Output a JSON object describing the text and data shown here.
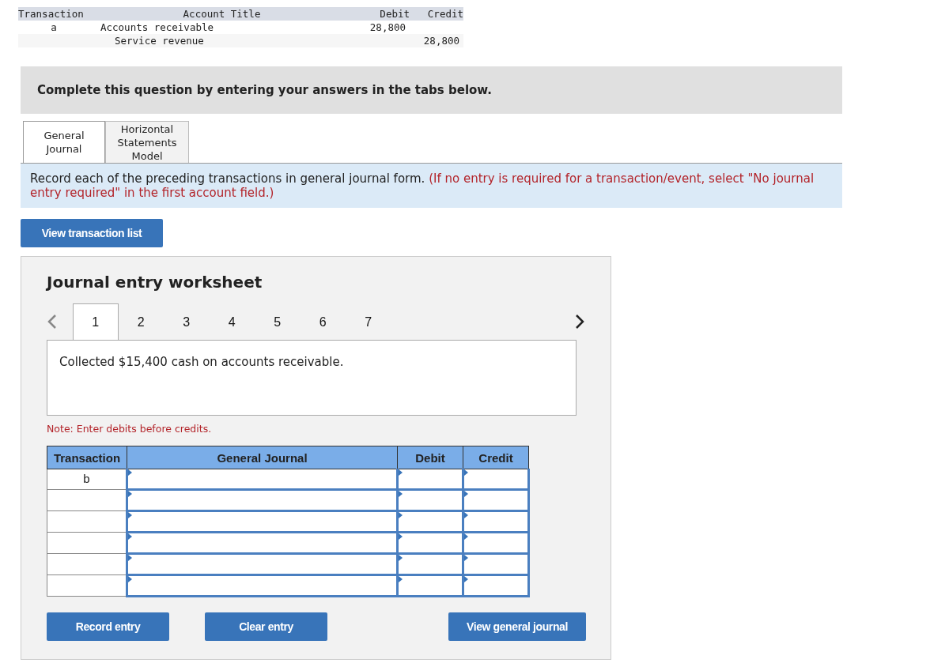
{
  "previous_entry": {
    "columns": [
      "Transaction",
      "Account Title",
      "Debit",
      "Credit"
    ],
    "rows": [
      {
        "transaction": "a",
        "account": "Accounts receivable",
        "debit": "28,800",
        "indented": false
      },
      {
        "account": "Service revenue",
        "credit": "28,800",
        "indented": true
      }
    ]
  },
  "banner": "Complete this question by entering your answers in the tabs below.",
  "tabs": [
    {
      "label": "General\nJournal",
      "selected": true
    },
    {
      "label": "Horizontal\nStatements\nModel",
      "selected": false
    }
  ],
  "instruction": {
    "text": "Record each of the preceding transactions in general journal form.",
    "hint": "(If no entry is required for a transaction/event, select \"No journal entry required\" in the first account field.)"
  },
  "view_transaction_list": "View transaction list",
  "worksheet": {
    "title": "Journal entry worksheet",
    "nav": {
      "prev_disabled": true,
      "next_disabled": false
    },
    "steps": [
      {
        "label": "1",
        "selected": true
      },
      {
        "label": "2",
        "selected": false
      },
      {
        "label": "3",
        "selected": false
      },
      {
        "label": "4",
        "selected": false
      },
      {
        "label": "5",
        "selected": false
      },
      {
        "label": "6",
        "selected": false
      },
      {
        "label": "7",
        "selected": false
      }
    ],
    "description": "Collected $15,400 cash on accounts receivable.",
    "note": "Note: Enter debits before credits.",
    "columns": [
      "Transaction",
      "General Journal",
      "Debit",
      "Credit"
    ],
    "rows": [
      {
        "transaction": "b"
      },
      {},
      {},
      {},
      {},
      {}
    ],
    "buttons": [
      "Record entry",
      "Clear entry",
      "View general journal"
    ]
  }
}
